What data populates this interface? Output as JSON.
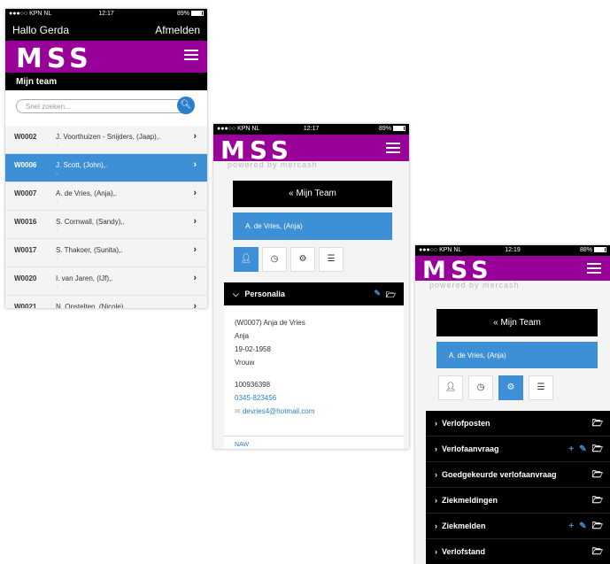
{
  "status_bars": [
    {
      "carrier": "●●●○○ KPN NL",
      "time": "12:17",
      "battery": "89%"
    },
    {
      "carrier": "●●●○○ KPN NL",
      "time": "12:17",
      "battery": "89%"
    },
    {
      "carrier": "●●●○○ KPN NL",
      "time": "12:19",
      "battery": "88%"
    }
  ],
  "app": {
    "logo": "MSS",
    "powered_by": "powered by mercash",
    "greeting": "Hallo Gerda",
    "logout": "Afmelden",
    "section_title": "Mijn team",
    "search_placeholder": "Snel zoeken..."
  },
  "employees": [
    {
      "code": "W0002",
      "name": "J. Voorthuizen - Snijders, (Jaap),.",
      "sub": "-",
      "active": false
    },
    {
      "code": "W0006",
      "name": "J. Scott, (John),.",
      "sub": "-",
      "active": true
    },
    {
      "code": "W0007",
      "name": "A. de Vries, (Anja),.",
      "sub": "-",
      "active": false
    },
    {
      "code": "W0016",
      "name": "S. Cornwall, (Sandy),.",
      "sub": "-",
      "active": false
    },
    {
      "code": "W0017",
      "name": "S. Thakoer, (Sunita),.",
      "sub": "-",
      "active": false
    },
    {
      "code": "W0020",
      "name": "I. van Jaren, (IJf),.",
      "sub": "-",
      "active": false
    },
    {
      "code": "W0021",
      "name": "N. Opstelten, (Nicole),.",
      "sub": "-",
      "active": false
    }
  ],
  "detail": {
    "back_button": "«  Mijn Team",
    "selected_employee": "A. de Vries, (Anja)",
    "panel_title": "Personalia",
    "lines": [
      "(W0007) Anja de Vries",
      "Anja",
      "19-02-1958",
      "Vrouw"
    ],
    "id_number": "100936398",
    "phone": "0345-823456",
    "email": "devries4@hotmail.com",
    "next_section": "NAW"
  },
  "settings": {
    "items": [
      {
        "label": "Verlofposten",
        "plus": false,
        "edit": false
      },
      {
        "label": "Verlofaanvraag",
        "plus": true,
        "edit": true
      },
      {
        "label": "Goedgekeurde verlofaanvraag",
        "plus": false,
        "edit": false
      },
      {
        "label": "Ziekmeldingen",
        "plus": false,
        "edit": false
      },
      {
        "label": "Ziekmelden",
        "plus": true,
        "edit": true
      },
      {
        "label": "Verlofstand",
        "plus": false,
        "edit": false
      }
    ]
  },
  "colors": {
    "brand": "#990099",
    "accent": "#3d8fd6",
    "dark": "#000000"
  }
}
